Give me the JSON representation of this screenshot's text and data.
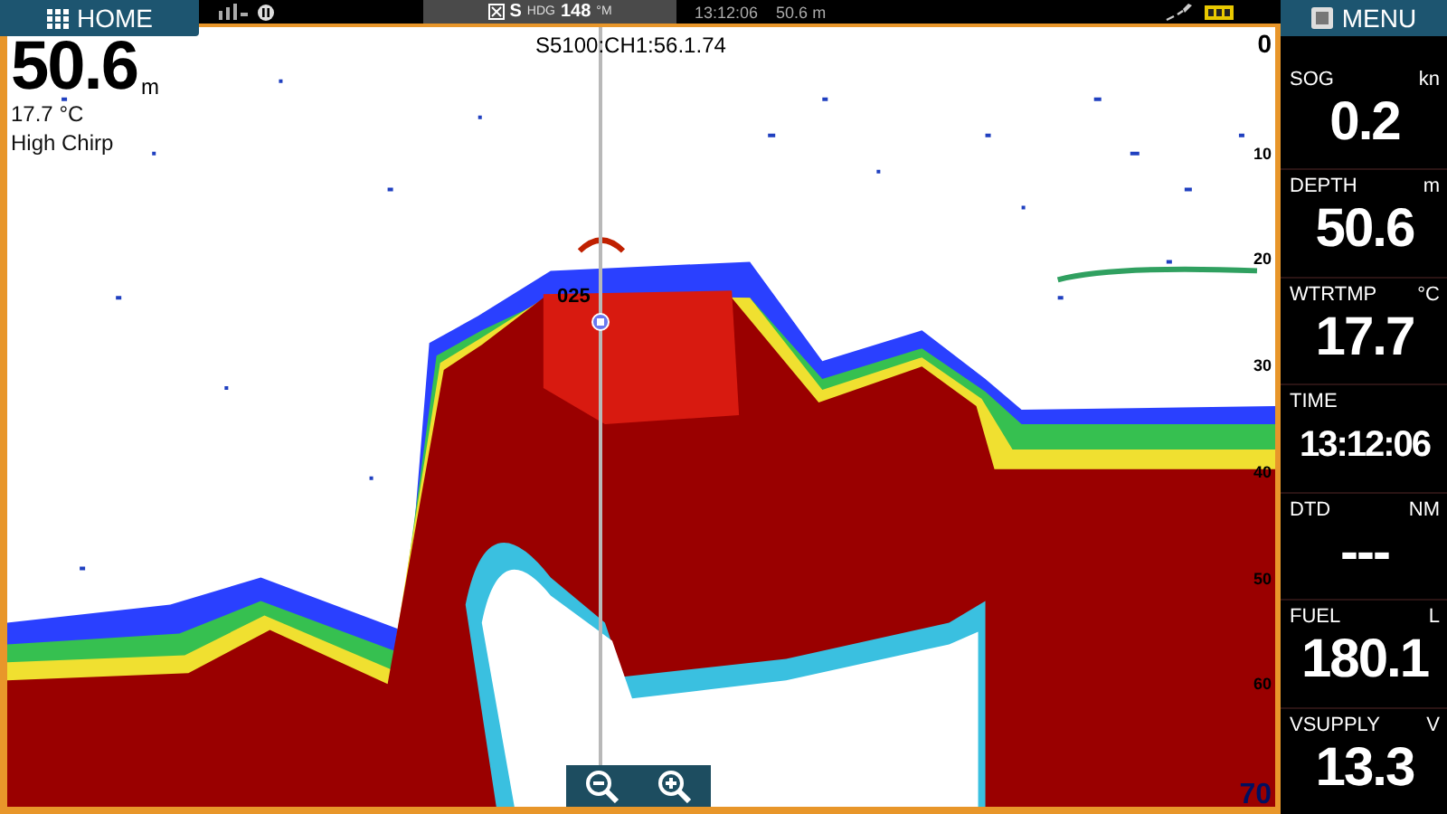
{
  "home_button": {
    "label": "HOME"
  },
  "menu_button": {
    "label": "MENU"
  },
  "status_bar": {
    "heading_prefix": "S",
    "heading_label": "HDG",
    "heading_value": "148",
    "heading_unit": "°M",
    "time": "13:12:06",
    "depth": "50.6 m"
  },
  "sonar": {
    "depth_value": "50.6",
    "depth_unit": "m",
    "water_temp": "17.7 °C",
    "frequency_mode": "High Chirp",
    "source": "S5100:CH1:56.1.74",
    "waypoint": "025",
    "depth_scale": [
      "0",
      "10",
      "20",
      "30",
      "40",
      "50",
      "60",
      "70"
    ]
  },
  "data_panel": [
    {
      "label": "SOG",
      "unit": "kn",
      "value": "0.2"
    },
    {
      "label": "DEPTH",
      "unit": "m",
      "value": "50.6"
    },
    {
      "label": "WTRTMP",
      "unit": "°C",
      "value": "17.7"
    },
    {
      "label": "TIME",
      "value": "13:12:06"
    },
    {
      "label": "DTD",
      "unit": "NM",
      "value": "---"
    },
    {
      "label": "FUEL",
      "unit": "L",
      "value": "180.1"
    },
    {
      "label": "VSUPPLY",
      "unit": "V",
      "value": "13.3"
    }
  ]
}
